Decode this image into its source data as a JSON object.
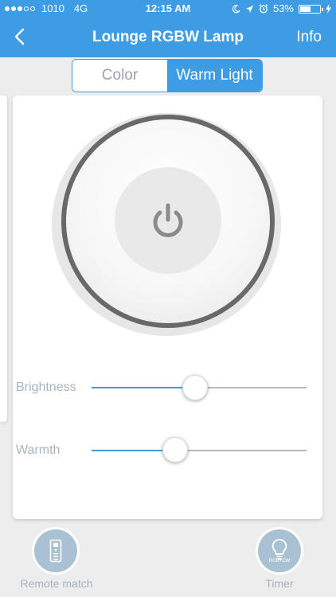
{
  "status_bar": {
    "carrier": "1010",
    "network": "4G",
    "time": "12:15 AM",
    "battery_percent": "53%",
    "battery_level": 0.53,
    "signal_bars_filled": 3,
    "signal_bars_total": 5,
    "icons": [
      "moon-icon",
      "location-arrow-icon",
      "alarm-icon",
      "battery-icon",
      "charging-bolt-icon"
    ]
  },
  "nav": {
    "back_icon": "chevron-left-icon",
    "title": "Lounge RGBW Lamp",
    "info_label": "Info"
  },
  "segments": {
    "color_label": "Color",
    "warm_light_label": "Warm Light",
    "selected": "Warm Light"
  },
  "power": {
    "icon": "power-icon"
  },
  "sliders": {
    "brightness": {
      "label": "Brightness",
      "value": 0.48
    },
    "warmth": {
      "label": "Warmth",
      "value": 0.39
    }
  },
  "toolbar": {
    "remote_match": {
      "label": "Remote match",
      "icon": "remote-control-icon"
    },
    "timer": {
      "label": "Timer",
      "icon": "lightbulb-icon",
      "tag": "RGB+CW"
    }
  },
  "colors": {
    "accent": "#3d9ce3",
    "background": "#ededed",
    "muted_label": "#a7b5bf",
    "dial_ring": "#696969",
    "tool_button": "#a9c2d3"
  }
}
